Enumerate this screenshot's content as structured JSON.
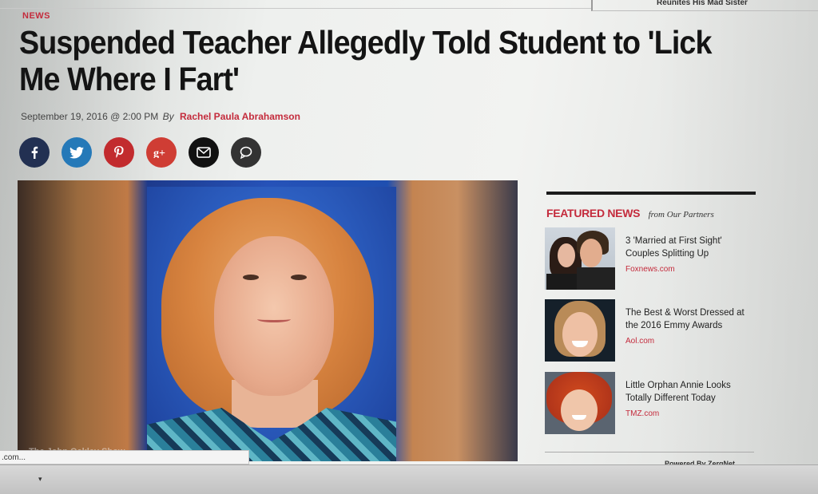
{
  "top_strip": {
    "text": "Reunites His Mad Sister"
  },
  "article": {
    "section": "NEWS",
    "headline": "Suspended Teacher Allegedly Told Student to 'Lick Me Where I Fart'",
    "date": "September 19, 2016 @ 2:00 PM",
    "by": "By",
    "author": "Rachel Paula Abrahamson",
    "photo_credit": "The John Oakley Show"
  },
  "share": [
    {
      "name": "facebook",
      "glyph": "f",
      "color": "#223052"
    },
    {
      "name": "twitter",
      "glyph": "t",
      "color": "#2579b8"
    },
    {
      "name": "pinterest",
      "glyph": "p",
      "color": "#c22b2e"
    },
    {
      "name": "google-plus",
      "glyph": "g+",
      "color": "#cf3d34"
    },
    {
      "name": "email",
      "glyph": "✉",
      "color": "#111111"
    },
    {
      "name": "comment",
      "glyph": "○",
      "color": "#333333"
    }
  ],
  "sidebar": {
    "title": "FEATURED NEWS",
    "subtitle": "from Our Partners",
    "items": [
      {
        "text": "3 'Married at First Sight' Couples Splitting Up",
        "source": "Foxnews.com"
      },
      {
        "text": "The Best & Worst Dressed at the 2016 Emmy Awards",
        "source": "Aol.com"
      },
      {
        "text": "Little Orphan Annie Looks Totally Different Today",
        "source": "TMZ.com"
      }
    ],
    "powered_by": "Powered By ZergNet"
  },
  "status_bar": {
    "text": ".com..."
  },
  "colors": {
    "accent": "#c42b3c",
    "headline": "#141414"
  }
}
